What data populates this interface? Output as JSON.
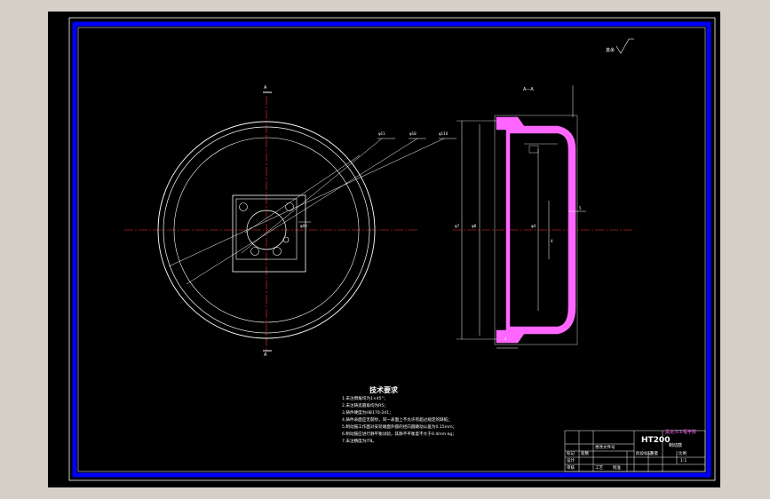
{
  "colors": {
    "window_bg": "#d4d0c8",
    "sheet_bg": "#000000",
    "border_blue": "#0000ff",
    "line_white": "#ffffff",
    "centerline_red": "#ff0000",
    "section_magenta": "#ff66ff"
  },
  "view": {
    "section_label_top": "A",
    "section_label_bottom": "A",
    "section_view_label": "A—A",
    "roughness_label": "其余"
  },
  "dimensions": {
    "hole_a": "φ11",
    "hole_b": "φ18",
    "hole_c": "φ110",
    "pcd": "φ00",
    "outer_dia": "φ7",
    "mid_dia": "φ8",
    "inner_dia": "φ4",
    "depth": "5",
    "small_a": "4",
    "small_b": "4"
  },
  "technical_requirements": {
    "title": "技术要求",
    "notes": [
      "1.未注倒角均为1×45°；",
      "2.未注铸造圆角均为R5；",
      "3.铸件硬度为HB170-241；",
      "4.铸件表面应无裂纹，同一表面上不允许有超过规定的缺陷；",
      "5.制动鼓工作面对安装端面外圆的径向圆跳动公差为0.15mm；",
      "6.制动鼓应进行静平衡试验，其静不平衡度不大于0.4mm·kg；",
      "7.未注精度为IT8。"
    ]
  },
  "title_block": {
    "material": "HT200",
    "company": "黑龙江工程学院",
    "drawing_no": "制动鼓",
    "scale": "1:1",
    "labels": [
      "标记",
      "处数",
      "更改文件号",
      "设计",
      "审核",
      "工艺",
      "批准",
      "阶段标记",
      "重量",
      "比例"
    ]
  }
}
